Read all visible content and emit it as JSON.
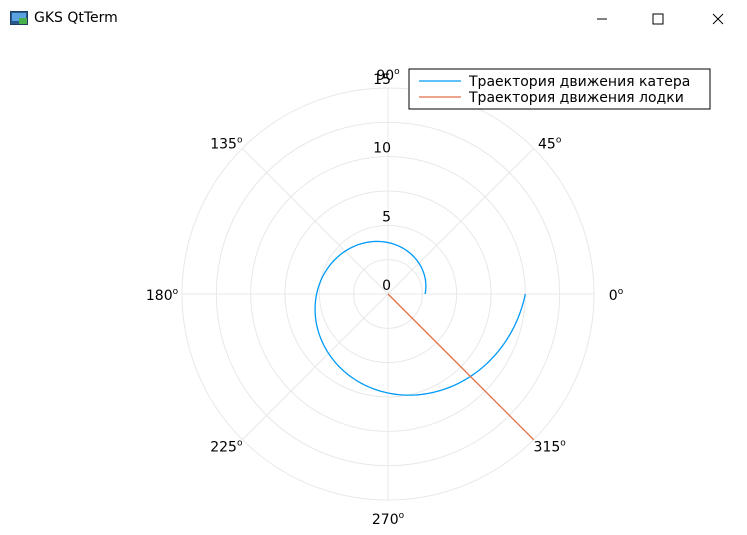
{
  "window": {
    "title": "GKS QtTerm",
    "icon": "gks-terminal-icon",
    "controls": [
      "minimize-icon",
      "maximize-icon",
      "close-icon"
    ]
  },
  "chart_data": {
    "type": "polar-line",
    "radial_range": [
      0,
      15
    ],
    "radial_ticks": [
      0,
      5,
      10,
      15
    ],
    "angle_ticks_deg": [
      0,
      45,
      90,
      135,
      180,
      225,
      270,
      315
    ],
    "angle_tick_labels": [
      "0",
      "45",
      "90",
      "135",
      "180",
      "225",
      "270",
      "315"
    ],
    "degree_mark": "o",
    "grid": true,
    "legend_position": "top-right",
    "series": [
      {
        "name": "Траектория движения катера",
        "color": "#009af9",
        "shape": "logarithmic spiral",
        "theta_start_deg": 0,
        "theta_end_deg": 360,
        "r_start": 2.7,
        "r_end": 10.0
      },
      {
        "name": "Траектория движения лодки",
        "color": "#e26f46",
        "shape": "ray",
        "theta_deg": 315,
        "r_start": 0,
        "r_end": 15
      }
    ]
  }
}
